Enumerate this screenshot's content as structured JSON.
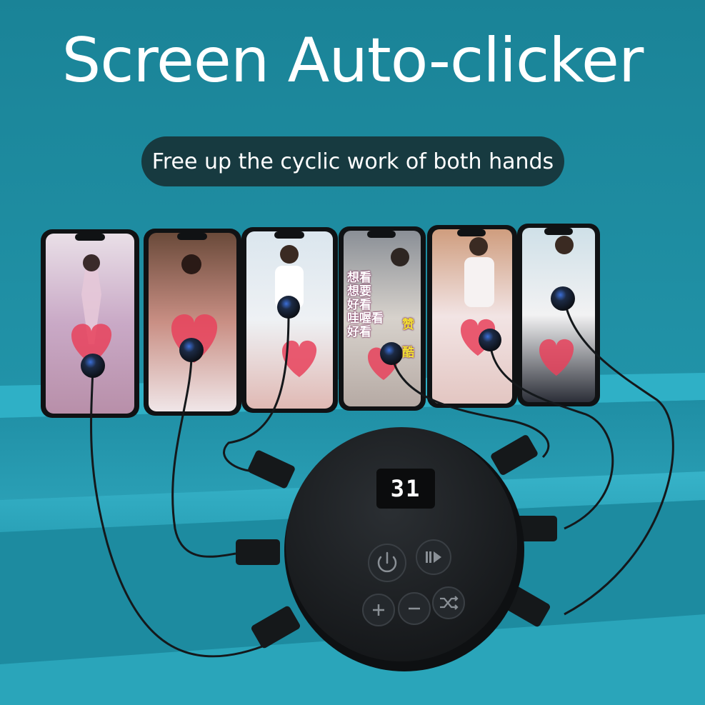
{
  "headline": "Screen Auto-clicker",
  "subtitle": "Free up the cyclic work of both hands",
  "display_value": "31",
  "phone_overlay_text": {
    "phone4_lines": [
      "想看",
      "想要",
      "好看",
      "哇喔看",
      "好看"
    ],
    "phone4_right": [
      "赞",
      "酷"
    ]
  },
  "buttons": [
    {
      "name": "power-button",
      "icon": "power-icon"
    },
    {
      "name": "play-pause-button",
      "icon": "play-pause-icon"
    },
    {
      "name": "plus-button",
      "icon": "plus-icon"
    },
    {
      "name": "minus-button",
      "icon": "minus-icon"
    },
    {
      "name": "shuffle-button",
      "icon": "shuffle-icon"
    }
  ],
  "colors": {
    "background": "#1f8fa3",
    "pill": "#173a40",
    "device": "#1b1e21",
    "display_bg": "#0d0f10",
    "heart": "#e8425c"
  }
}
